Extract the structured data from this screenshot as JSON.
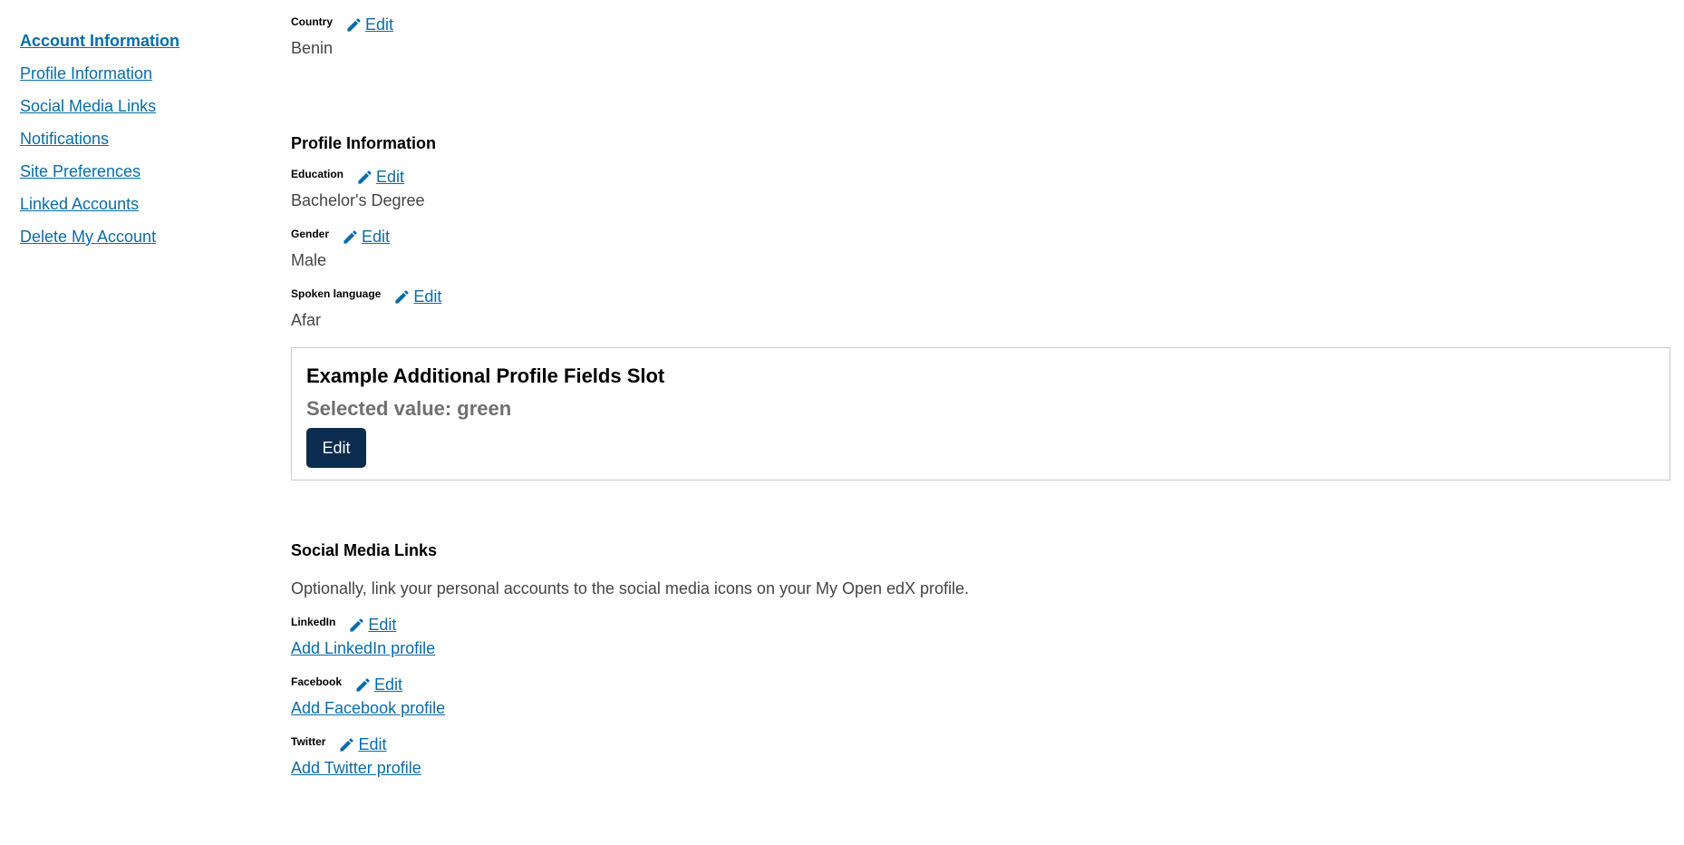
{
  "sidebar": {
    "items": [
      {
        "label": "Account Information"
      },
      {
        "label": "Profile Information"
      },
      {
        "label": "Social Media Links"
      },
      {
        "label": "Notifications"
      },
      {
        "label": "Site Preferences"
      },
      {
        "label": "Linked Accounts"
      },
      {
        "label": "Delete My Account"
      }
    ]
  },
  "country": {
    "label": "Country",
    "edit_label": "Edit",
    "value": "Benin"
  },
  "profile": {
    "title": "Profile Information",
    "education": {
      "label": "Education",
      "edit_label": "Edit",
      "value": "Bachelor's Degree"
    },
    "gender": {
      "label": "Gender",
      "edit_label": "Edit",
      "value": "Male"
    },
    "spoken_language": {
      "label": "Spoken language",
      "edit_label": "Edit",
      "value": "Afar"
    }
  },
  "slot": {
    "title": "Example Additional Profile Fields Slot",
    "selected_value": "Selected value: green",
    "button_label": "Edit"
  },
  "social": {
    "title": "Social Media Links",
    "description": "Optionally, link your personal accounts to the social media icons on your My Open edX profile.",
    "linkedin": {
      "label": "LinkedIn",
      "edit_label": "Edit",
      "add_label": "Add LinkedIn profile"
    },
    "facebook": {
      "label": "Facebook",
      "edit_label": "Edit",
      "add_label": "Add Facebook profile"
    },
    "twitter": {
      "label": "Twitter",
      "edit_label": "Edit",
      "add_label": "Add Twitter profile"
    }
  },
  "icons": {
    "edit": "pencil-icon"
  },
  "colors": {
    "link": "#0a6ca7",
    "button_bg": "#0b2b4f",
    "heading": "#000000",
    "body_text": "#454545",
    "muted_text": "#707070",
    "border": "#c9c9c9"
  }
}
